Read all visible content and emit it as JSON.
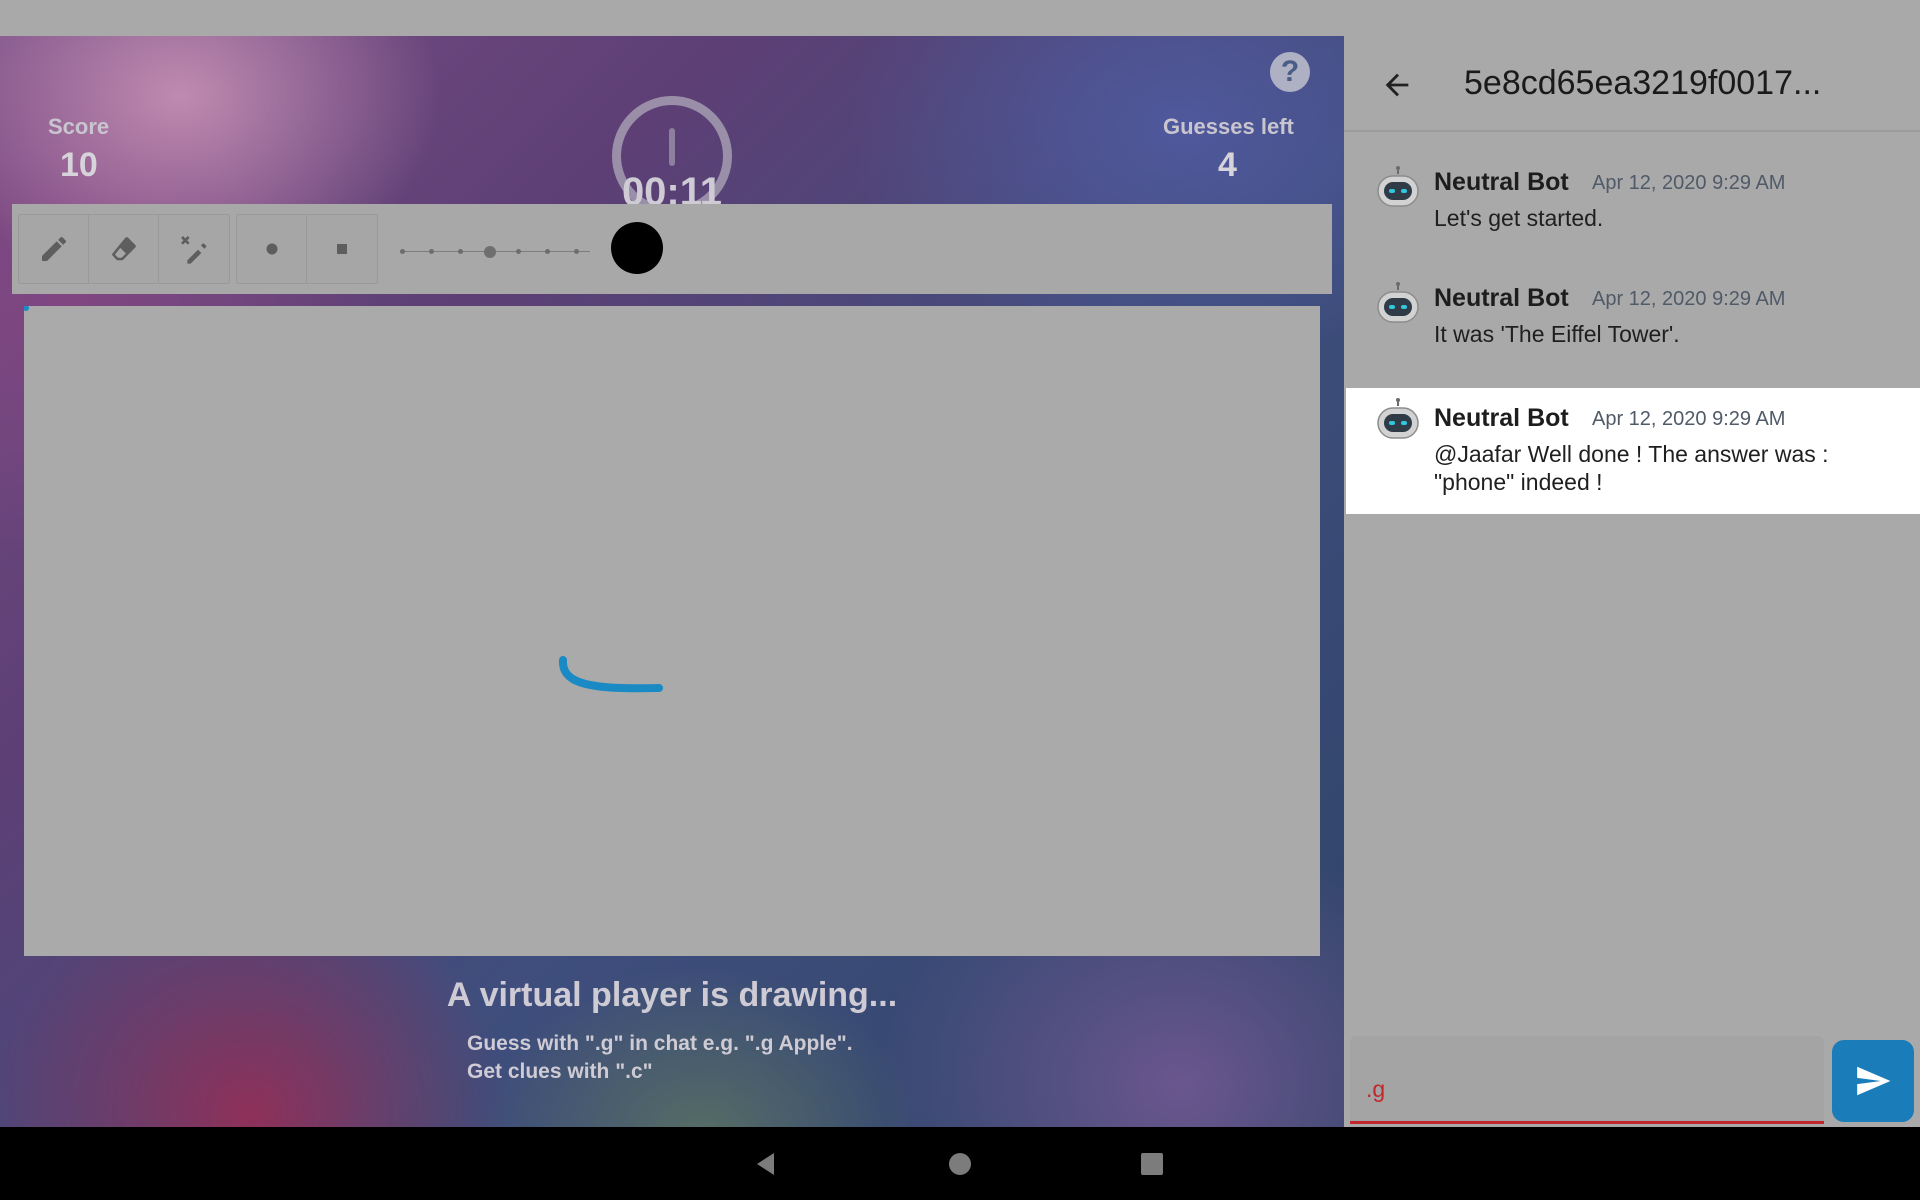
{
  "game": {
    "score_label": "Score",
    "score_value": "10",
    "guesses_label": "Guesses left",
    "guesses_value": "4",
    "timer": "00:11",
    "help_symbol": "?",
    "status_title": "A virtual player is drawing...",
    "hint_guess": "Guess with \".g\" in chat e.g. \".g Apple\".",
    "hint_clue": "Get clues with \".c\"",
    "selected_color": "#000000",
    "stroke_color": "#1a8ac4",
    "tools": [
      "pencil-icon",
      "eraser-icon",
      "grid-eraser-icon"
    ],
    "tip_shapes": [
      "round-tip-icon",
      "square-tip-icon"
    ]
  },
  "chat": {
    "title": "5e8cd65ea3219f0017...",
    "messages": [
      {
        "author": "Neutral Bot",
        "time": "Apr 12, 2020 9:29 AM",
        "text": "Let's get started."
      },
      {
        "author": "Neutral Bot",
        "time": "Apr 12, 2020 9:29 AM",
        "text": "It was 'The Eiffel Tower'."
      },
      {
        "author": "Neutral Bot",
        "time": "Apr 12, 2020 9:29 AM",
        "text": "@Jaafar Well done ! The answer was : \"phone\" indeed !"
      }
    ],
    "input_value": ".g",
    "accent_color": "#1a7cb9",
    "input_underline_color": "#c1272d"
  },
  "navbar": {
    "buttons": [
      "back-triangle-icon",
      "home-circle-icon",
      "recents-square-icon"
    ]
  }
}
